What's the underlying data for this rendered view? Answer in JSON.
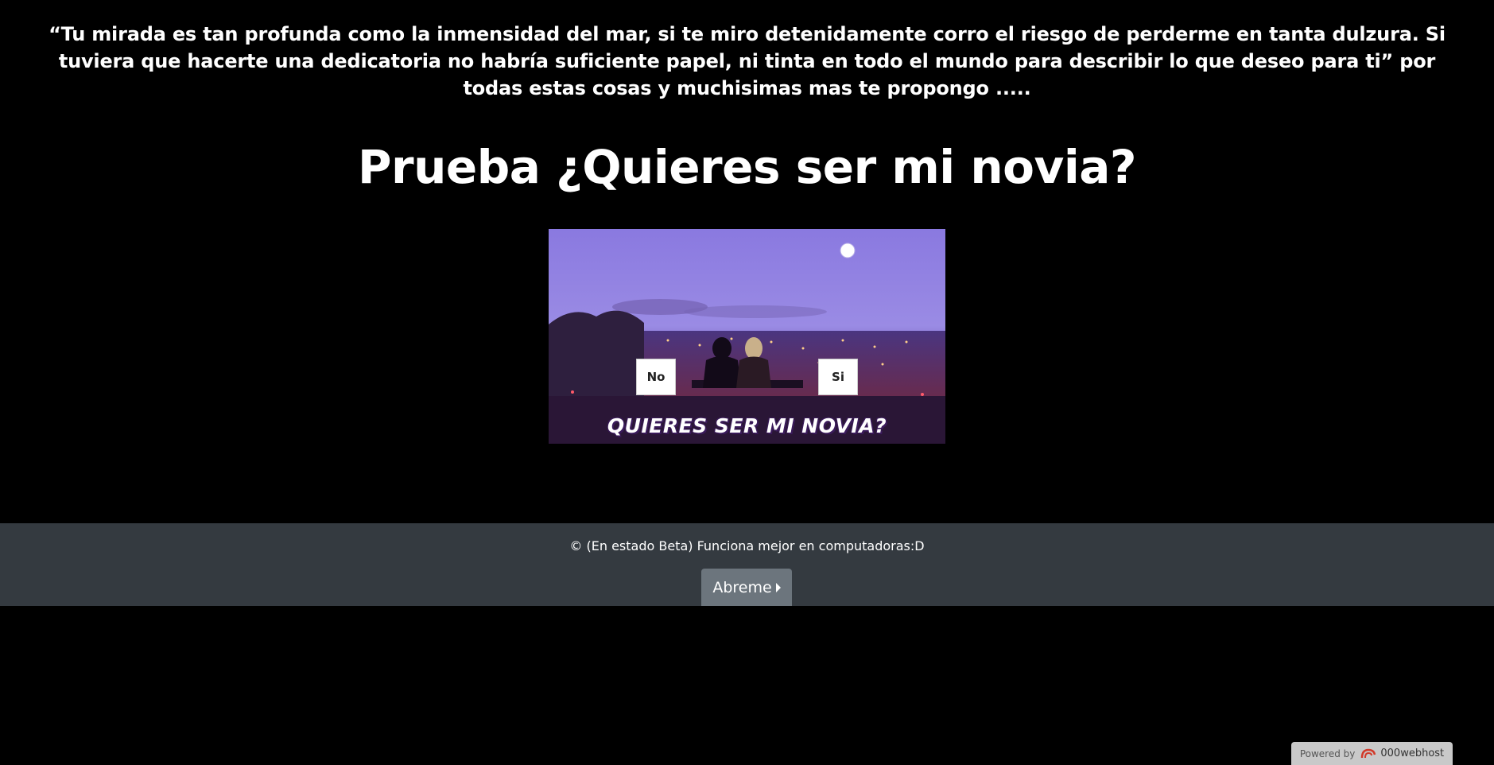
{
  "intro": {
    "quote": "“Tu mirada es tan profunda como la inmensidad del mar, si te miro detenidamente corro el riesgo de perderme en tanta dulzura. Si tuviera que hacerte una dedicatoria no habría suficiente papel, ni tinta en todo el mundo para describir lo que deseo para ti” por todas estas cosas y muchisimas mas te propongo ....."
  },
  "headline": "Prueba ¿Quieres ser mi novia?",
  "photo": {
    "caption": "QUIERES SER MI NOVIA?",
    "no_label": "No",
    "si_label": "Si"
  },
  "footer": {
    "text": "© (En estado Beta) Funciona mejor en computadoras:D",
    "button_label": "Abreme"
  },
  "host_badge": {
    "powered_label": "Powered by",
    "brand": "000webhost"
  },
  "colors": {
    "background": "#000000",
    "footer": "#343a40",
    "button": "#6c757d"
  }
}
